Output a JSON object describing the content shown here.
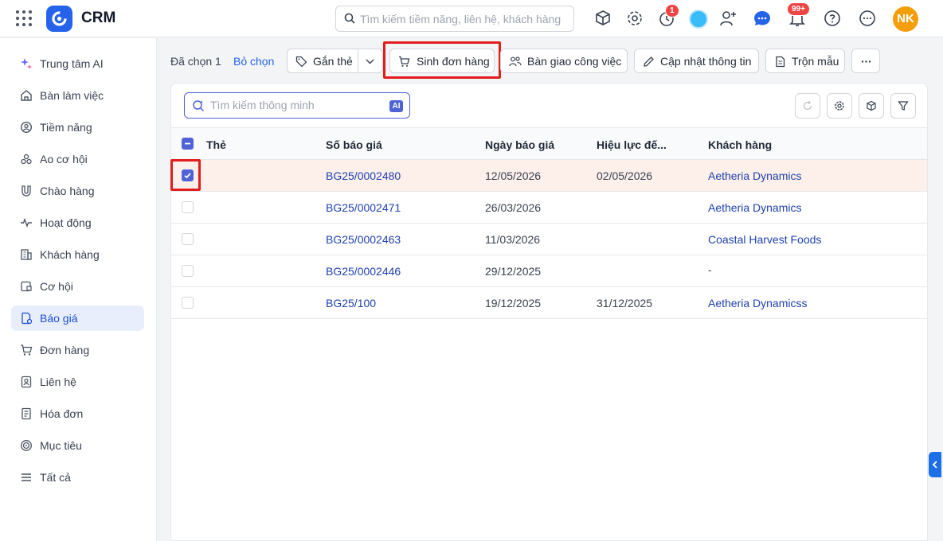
{
  "app": {
    "name": "CRM"
  },
  "header": {
    "search_placeholder": "Tìm kiếm tiềm năng, liên hệ, khách hàng",
    "timer_badge": "1",
    "notification_badge": "99+",
    "user_initials": "NK"
  },
  "sidebar": {
    "items": [
      {
        "label": "Trung tâm AI",
        "icon": "sparkle-icon"
      },
      {
        "label": "Bàn làm việc",
        "icon": "home-icon"
      },
      {
        "label": "Tiềm năng",
        "icon": "lead-icon"
      },
      {
        "label": "Ao cơ hội",
        "icon": "pool-icon"
      },
      {
        "label": "Chào hàng",
        "icon": "magnet-icon"
      },
      {
        "label": "Hoạt động",
        "icon": "activity-icon"
      },
      {
        "label": "Khách hàng",
        "icon": "building-icon"
      },
      {
        "label": "Cơ hội",
        "icon": "opportunity-icon"
      },
      {
        "label": "Báo giá",
        "icon": "quote-icon",
        "active": true
      },
      {
        "label": "Đơn hàng",
        "icon": "cart-icon"
      },
      {
        "label": "Liên hệ",
        "icon": "contact-icon"
      },
      {
        "label": "Hóa đơn",
        "icon": "invoice-icon"
      },
      {
        "label": "Mục tiêu",
        "icon": "target-icon"
      },
      {
        "label": "Tất cả",
        "icon": "menu-icon"
      }
    ]
  },
  "actions": {
    "selected_text": "Đã chọn 1",
    "deselect": "Bỏ chọn",
    "tag": "Gắn thẻ",
    "create_order": "Sinh đơn hàng",
    "handover": "Bàn giao công việc",
    "update_info": "Cập nhật thông tin",
    "merge_template": "Trộn mẫu"
  },
  "table": {
    "search_placeholder": "Tìm kiếm thông minh",
    "ai_tag": "AI",
    "columns": [
      "Thẻ",
      "Số báo giá",
      "Ngày báo giá",
      "Hiệu lực đế...",
      "Khách hàng"
    ],
    "rows": [
      {
        "checked": true,
        "tag": "",
        "number": "BG25/0002480",
        "date": "12/05/2026",
        "valid_until": "02/05/2026",
        "customer": "Aetheria Dynamics"
      },
      {
        "checked": false,
        "tag": "",
        "number": "BG25/0002471",
        "date": "26/03/2026",
        "valid_until": "",
        "customer": "Aetheria Dynamics"
      },
      {
        "checked": false,
        "tag": "",
        "number": "BG25/0002463",
        "date": "11/03/2026",
        "valid_until": "",
        "customer": "Coastal Harvest Foods"
      },
      {
        "checked": false,
        "tag": "",
        "number": "BG25/0002446",
        "date": "29/12/2025",
        "valid_until": "",
        "customer": "-"
      },
      {
        "checked": false,
        "tag": "",
        "number": "BG25/100",
        "date": "19/12/2025",
        "valid_until": "31/12/2025",
        "customer": "Aetheria Dynamicss"
      }
    ]
  },
  "colors": {
    "accent": "#4f63d7",
    "link": "#1e40af",
    "highlight": "#e11d1d",
    "selected_row": "#fdf0ea"
  }
}
